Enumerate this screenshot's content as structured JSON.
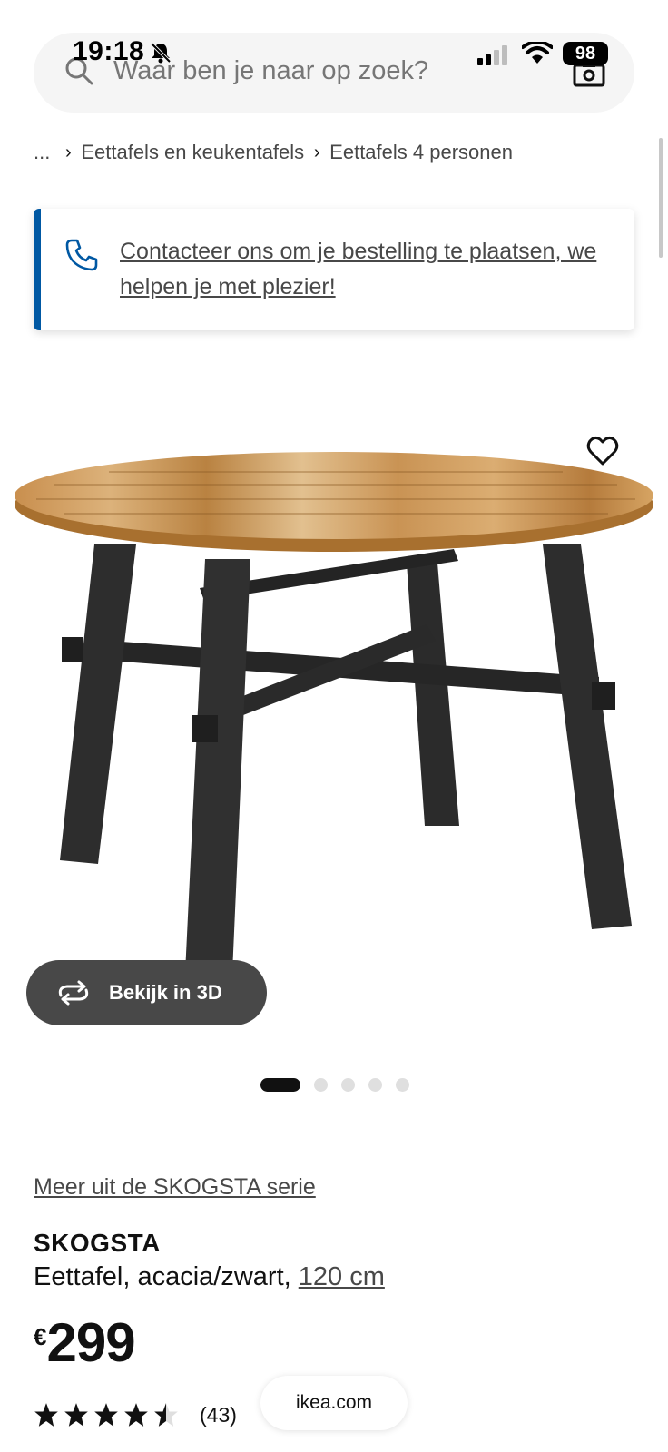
{
  "status_bar": {
    "time": "19:18",
    "battery": "98"
  },
  "search": {
    "placeholder": "Waar ben je naar op zoek?"
  },
  "breadcrumb": {
    "ellipsis": "...",
    "items": [
      "Eettafels en keukentafels",
      "Eettafels 4 personen"
    ]
  },
  "contact_banner": {
    "text": "Contacteer ons om je bestelling te plaatsen, we helpen je met plezier!"
  },
  "gallery": {
    "view_3d_label": "Bekijk in 3D",
    "total_images": 5,
    "active_index": 0
  },
  "product": {
    "series_link": "Meer uit de SKOGSTA serie",
    "name": "SKOGSTA",
    "description": "Eettafel, acacia/zwart, ",
    "size_link": "120 cm",
    "currency": "€",
    "price": "299",
    "rating": 4.5,
    "review_count": "(43)"
  },
  "browser": {
    "url": "ikea.com"
  },
  "colors": {
    "accent_blue": "#0058a3",
    "button_dark": "#484848",
    "wood_light": "#d2a46a",
    "frame_black": "#2b2b2b"
  }
}
